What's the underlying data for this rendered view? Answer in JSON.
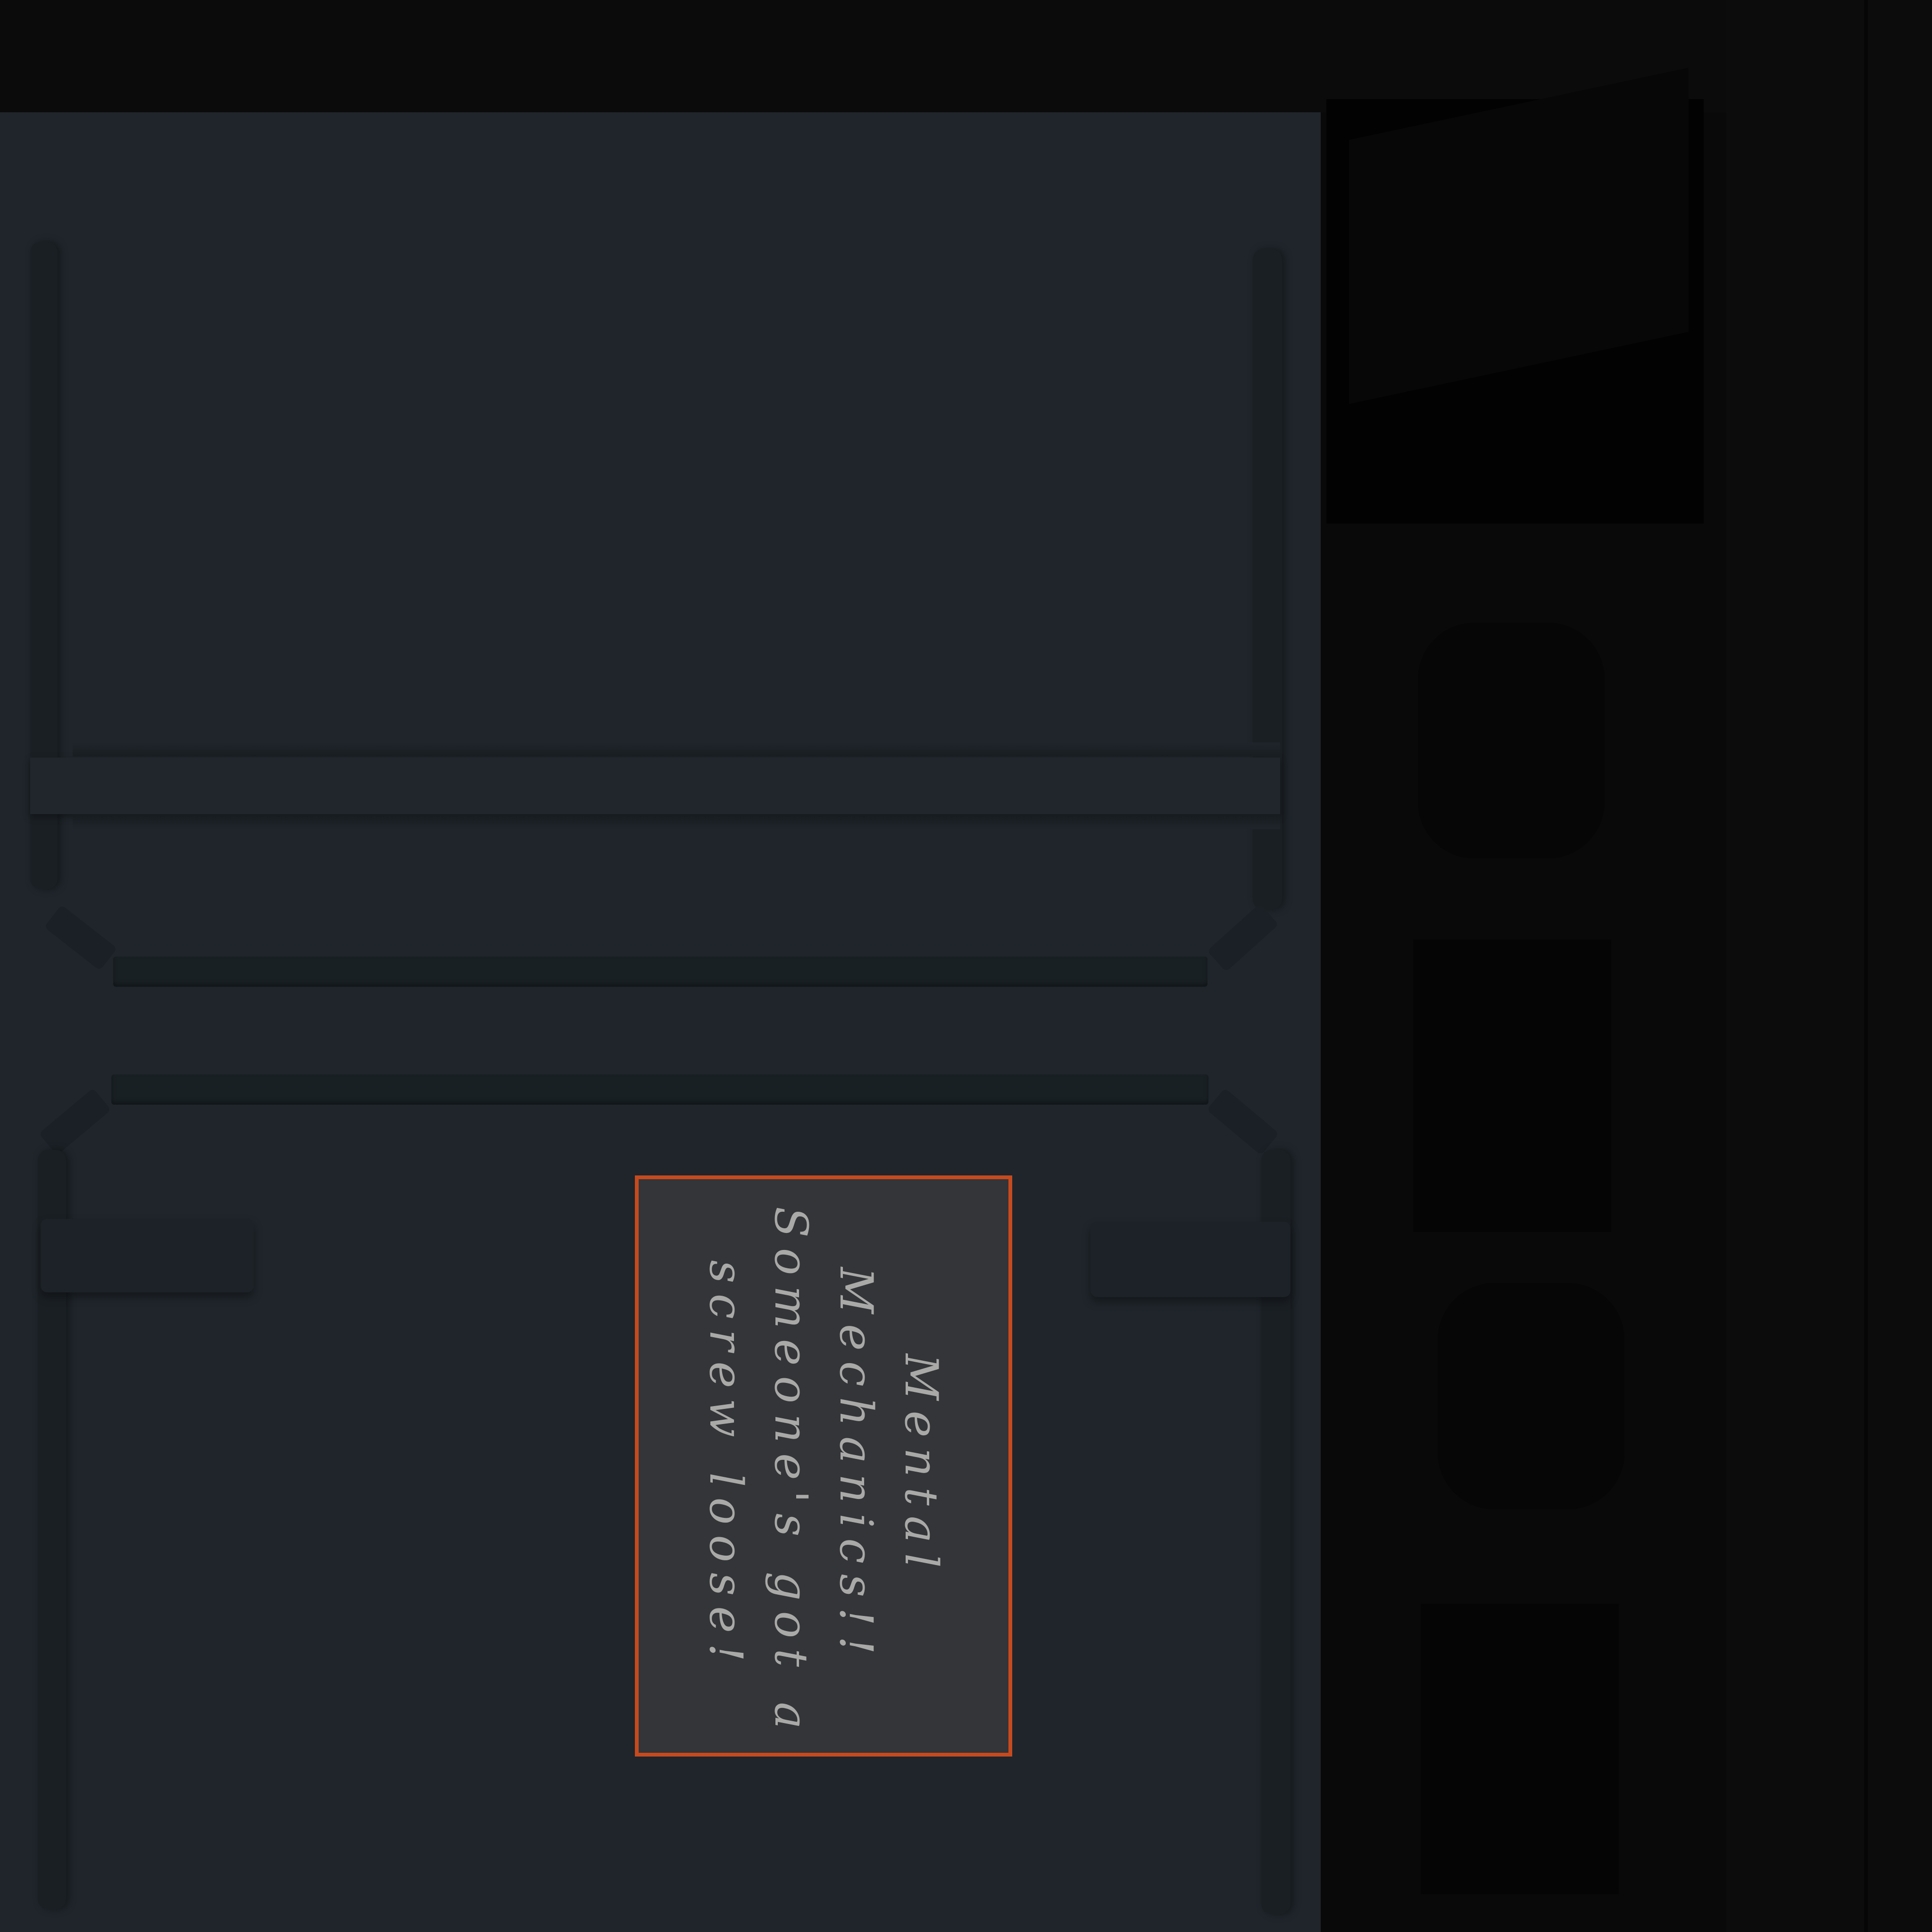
{
  "sign": {
    "line1": "Mental",
    "line2": "Mechanics!!",
    "line3": "Someone's got a",
    "line4": "screw loose!"
  },
  "colors": {
    "background": "#0b0b0c",
    "panel": "#1f252b",
    "sign_fill": "#333538",
    "sign_border": "#c64a1e",
    "sign_text": "#a9a9a7"
  }
}
